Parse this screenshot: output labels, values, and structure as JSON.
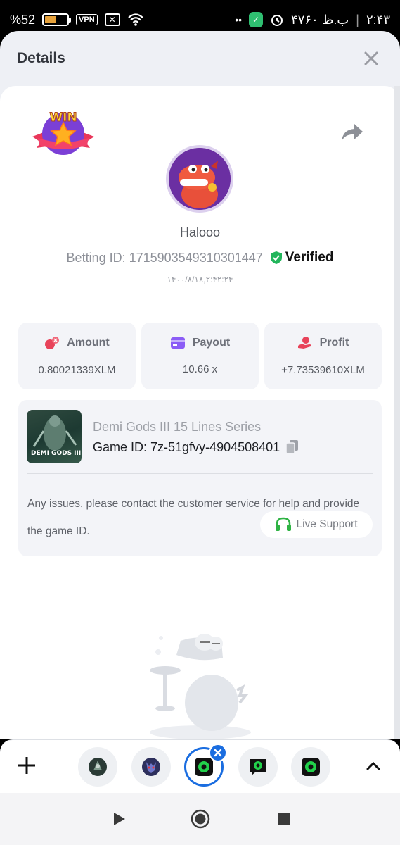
{
  "status_bar": {
    "battery_percent": "%52",
    "battery_level": 0.52,
    "vpn_label": "VPN",
    "date_time_text": "۴ب.ظ ۷۶۰",
    "clock": "۲:۴۳"
  },
  "sheet": {
    "title": "Details"
  },
  "bet": {
    "win_label": "WIN",
    "username": "Halooo",
    "betting_id": "Betting ID: 1715903549310301447",
    "verified_label": "Verified",
    "timestamp": "۱۴۰۰/۸/۱۸,۲:۴۲:۲۴"
  },
  "stats": [
    {
      "label": "Amount",
      "value": "0.80021339XLM",
      "icon": "coins-icon",
      "color": "#e8435a"
    },
    {
      "label": "Payout",
      "value": "10.66 x",
      "icon": "card-icon",
      "color": "#8b5cf6"
    },
    {
      "label": "Profit",
      "value": "+7.73539610XLM",
      "icon": "hand-coin-icon",
      "color": "#e8435a"
    }
  ],
  "game": {
    "name": "Demi Gods III 15 Lines Series",
    "id_text": "Game ID: 7z-51gfvy-4904508401",
    "thumb_caption": "DEMI GODS III",
    "issue_text": "Any issues, please contact the customer service for help and provide the game ID.",
    "live_support_label": "Live Support"
  },
  "colors": {
    "accent_blue": "#1a6de0",
    "verified_green": "#22b55b",
    "support_green": "#2fb344"
  },
  "tabs": {
    "items": [
      {
        "name": "tab-game-dragon",
        "icon": "dragon-icon"
      },
      {
        "name": "tab-game-wolf",
        "icon": "wolf-icon"
      },
      {
        "name": "tab-game-active",
        "icon": "bc-game-icon",
        "active": true
      },
      {
        "name": "tab-game-chat",
        "icon": "bc-chat-icon"
      },
      {
        "name": "tab-game-other",
        "icon": "bc-game-icon"
      }
    ]
  }
}
